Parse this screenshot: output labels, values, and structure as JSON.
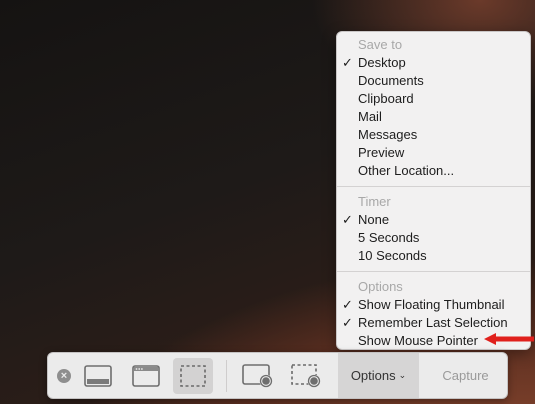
{
  "menu": {
    "save_to": {
      "header": "Save to",
      "items": [
        {
          "label": "Desktop",
          "checked": true
        },
        {
          "label": "Documents",
          "checked": false
        },
        {
          "label": "Clipboard",
          "checked": false
        },
        {
          "label": "Mail",
          "checked": false
        },
        {
          "label": "Messages",
          "checked": false
        },
        {
          "label": "Preview",
          "checked": false
        },
        {
          "label": "Other Location...",
          "checked": false
        }
      ]
    },
    "timer": {
      "header": "Timer",
      "items": [
        {
          "label": "None",
          "checked": true
        },
        {
          "label": "5 Seconds",
          "checked": false
        },
        {
          "label": "10 Seconds",
          "checked": false
        }
      ]
    },
    "options": {
      "header": "Options",
      "items": [
        {
          "label": "Show Floating Thumbnail",
          "checked": true
        },
        {
          "label": "Remember Last Selection",
          "checked": true
        },
        {
          "label": "Show Mouse Pointer",
          "checked": false
        }
      ]
    },
    "check_glyph": "✓"
  },
  "toolbar": {
    "close_glyph": "×",
    "options_label": "Options",
    "options_chevron": "⌄",
    "capture_label": "Capture"
  },
  "colors": {
    "annotation_arrow": "#e0201c",
    "menu_bg": "#f2f1f1",
    "toolbar_bg": "#ebebeb"
  }
}
